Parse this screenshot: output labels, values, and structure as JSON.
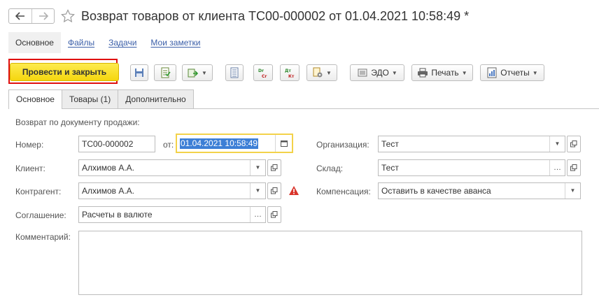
{
  "window": {
    "title": "Возврат товаров от клиента ТС00-000002 от 01.04.2021 10:58:49 *"
  },
  "nav": {
    "back_glyph": "🡐",
    "forward_glyph": "🡒"
  },
  "section_nav": {
    "items": [
      {
        "label": "Основное"
      },
      {
        "label": "Файлы"
      },
      {
        "label": "Задачи"
      },
      {
        "label": "Мои заметки"
      }
    ]
  },
  "toolbar": {
    "post_close_label": "Провести и закрыть",
    "edo_label": "ЭДО",
    "print_label": "Печать",
    "reports_label": "Отчеты"
  },
  "tabs": [
    {
      "label": "Основное"
    },
    {
      "label": "Товары (1)"
    },
    {
      "label": "Дополнительно"
    }
  ],
  "form": {
    "return_label": "Возврат по документу продажи:",
    "number_label": "Номер:",
    "number_value": "ТС00-000002",
    "date_from_label": "от:",
    "date_value": "01.04.2021 10:58:49",
    "client_label": "Клиент:",
    "client_value": "Алхимов А.А.",
    "counterparty_label": "Контрагент:",
    "counterparty_value": "Алхимов А.А.",
    "agreement_label": "Соглашение:",
    "agreement_value": "Расчеты в валюте",
    "organization_label": "Организация:",
    "organization_value": "Тест",
    "warehouse_label": "Склад:",
    "warehouse_value": "Тест",
    "compensation_label": "Компенсация:",
    "compensation_value": "Оставить в качестве аванса",
    "comment_label": "Комментарий:"
  },
  "colors": {
    "accent_yellow": "#f5d60e",
    "highlight_red": "#e01010",
    "link_blue": "#3a5ea8",
    "warning_red": "#d9342b"
  }
}
